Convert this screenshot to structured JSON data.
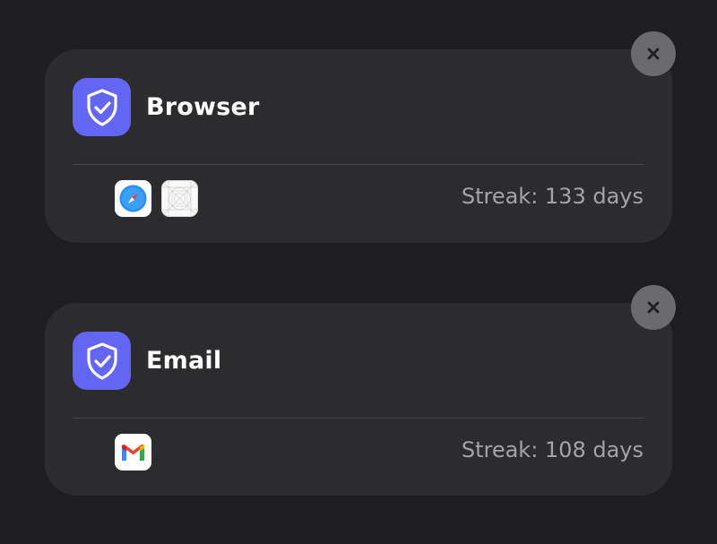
{
  "groups": [
    {
      "title": "Browser",
      "streak": "Streak: 133 days",
      "apps": [
        "safari-icon",
        "placeholder-app-icon"
      ]
    },
    {
      "title": "Email",
      "streak": "Streak: 108 days",
      "apps": [
        "gmail-icon"
      ]
    }
  ],
  "colors": {
    "accent": "#6366f5",
    "card": "#2c2c2e",
    "background": "#1e1e20",
    "close_button": "#6b6b6f"
  }
}
